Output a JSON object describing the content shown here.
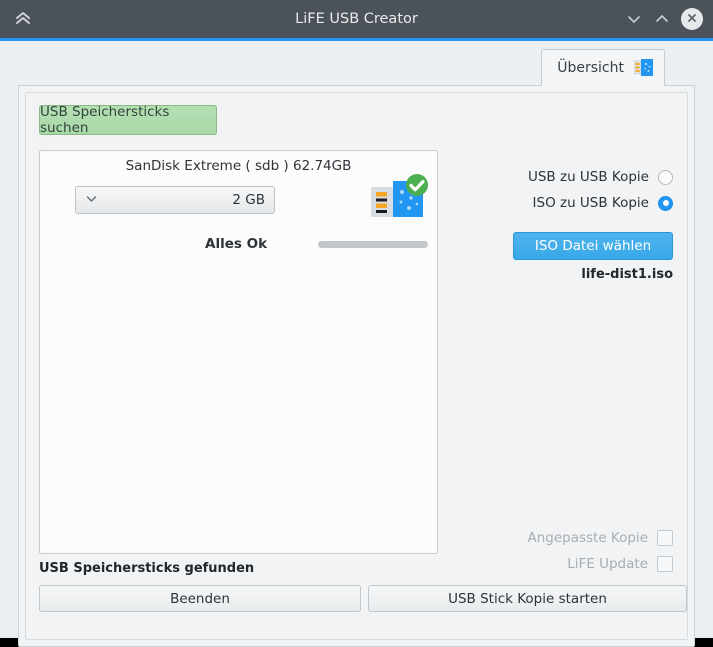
{
  "window": {
    "title": "LiFE USB Creator",
    "shade_icon": "double-chevron-up-icon",
    "minimize_icon": "chevron-down-icon",
    "maximize_icon": "chevron-up-icon",
    "close_icon": "close-icon",
    "accent_color": "#2196f3",
    "titlebar_color": "#4b5259"
  },
  "tabs": [
    {
      "label": "Übersicht",
      "icon": "usb-stick-icon",
      "selected": true
    }
  ],
  "left": {
    "scan_button": "USB Speichersticks suchen",
    "scan_button_color": "#b5e0b4",
    "device": {
      "title": "SanDisk Extreme ( sdb ) 62.74GB",
      "size_value": "2 GB",
      "size_dropdown_icon": "chevron-down-icon",
      "device_icon": "usb-stick-ok-icon",
      "status": "Alles Ok",
      "progress_percent": 0
    }
  },
  "right": {
    "copy_modes": [
      {
        "label": "USB zu USB Kopie",
        "selected": false
      },
      {
        "label": "ISO zu USB Kopie",
        "selected": true
      }
    ],
    "iso_button": "ISO Datei wählen",
    "iso_button_color": "#38a8e8",
    "iso_filename": "life-dist1.iso",
    "options": [
      {
        "label": "Angepasste Kopie",
        "checked": false,
        "disabled": true
      },
      {
        "label": "LiFE Update",
        "checked": false,
        "disabled": true
      }
    ]
  },
  "bottom": {
    "status": "USB Speichersticks gefunden",
    "quit_button": "Beenden",
    "start_button": "USB Stick Kopie starten"
  }
}
